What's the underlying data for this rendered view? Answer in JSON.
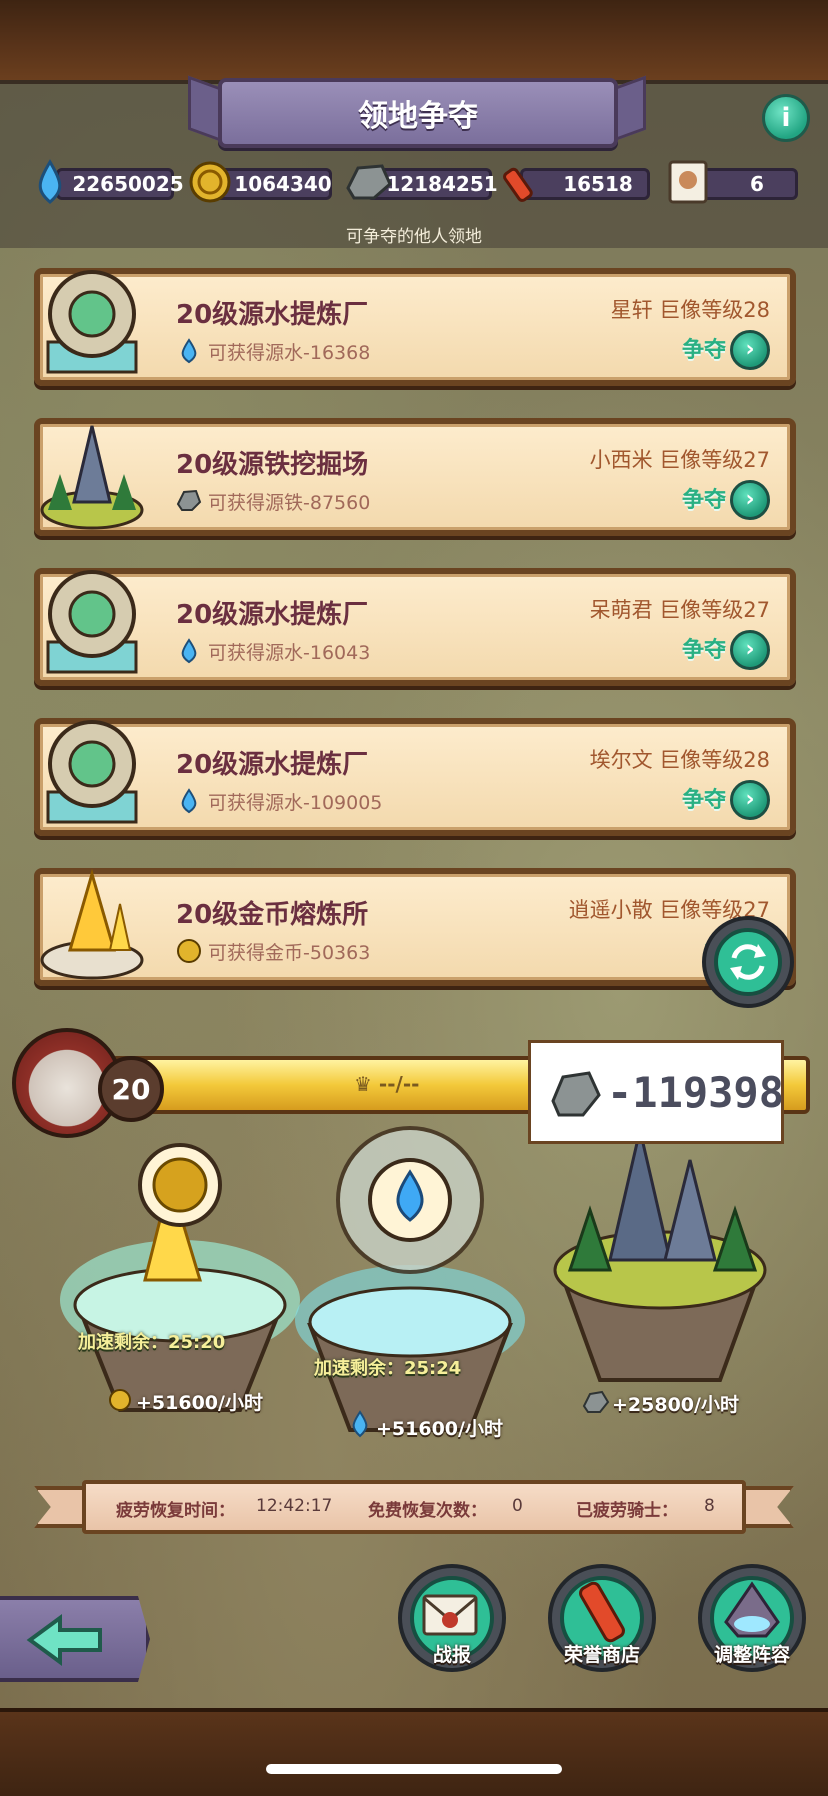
{
  "header": {
    "title": "领地争夺",
    "subtitle": "可争夺的他人领地",
    "resources": [
      {
        "icon": "water-drop-icon",
        "value": "22650025"
      },
      {
        "icon": "gold-coin-icon",
        "value": "1064340"
      },
      {
        "icon": "iron-ore-icon",
        "value": "12184251"
      },
      {
        "icon": "honor-scroll-icon",
        "value": "16518"
      },
      {
        "icon": "strength-card-icon",
        "value": "6"
      }
    ]
  },
  "cards": [
    {
      "name": "20级源水提炼厂",
      "reward": "可获得源水-16368",
      "owner": "星轩  巨像等级28",
      "action": "争夺",
      "reward_icon": "water-drop-icon"
    },
    {
      "name": "20级源铁挖掘场",
      "reward": "可获得源铁-87560",
      "owner": "小西米  巨像等级27",
      "action": "争夺",
      "reward_icon": "iron-ore-icon"
    },
    {
      "name": "20级源水提炼厂",
      "reward": "可获得源水-16043",
      "owner": "呆萌君  巨像等级27",
      "action": "争夺",
      "reward_icon": "water-drop-icon"
    },
    {
      "name": "20级源水提炼厂",
      "reward": "可获得源水-109005",
      "owner": "埃尔文  巨像等级28",
      "action": "争夺",
      "reward_icon": "water-drop-icon"
    },
    {
      "name": "20级金币熔炼所",
      "reward": "可获得金币-50363",
      "owner": "逍遥小散  巨像等级27",
      "action": "争",
      "reward_icon": "gold-coin-icon"
    }
  ],
  "hero": {
    "level": "20",
    "bar_label": "--/--",
    "total_ore": "-119398"
  },
  "islands": [
    {
      "boost": "加速剩余：25:20",
      "rate": "+51600/小时",
      "icon": "gold-coin-icon"
    },
    {
      "boost": "加速剩余：25:24",
      "rate": "+51600/小时",
      "icon": "water-drop-icon"
    },
    {
      "boost": "",
      "rate": "+25800/小时",
      "icon": "iron-ore-icon"
    }
  ],
  "fatigue": {
    "recover_label": "疲劳恢复时间：",
    "recover_value": "12:42:17",
    "free_label": "免费恢复次数：",
    "free_value": "0",
    "tired_label": "已疲劳骑士：",
    "tired_value": "8"
  },
  "buttons": {
    "report": "战报",
    "honor_shop": "荣誉商店",
    "adjust_lineup": "调整阵容"
  },
  "colors": {
    "accent_green": "#2ab083",
    "banner_purple": "#7b6f9c",
    "card_bg": "#fdeccd",
    "wood": "#5a341a"
  }
}
